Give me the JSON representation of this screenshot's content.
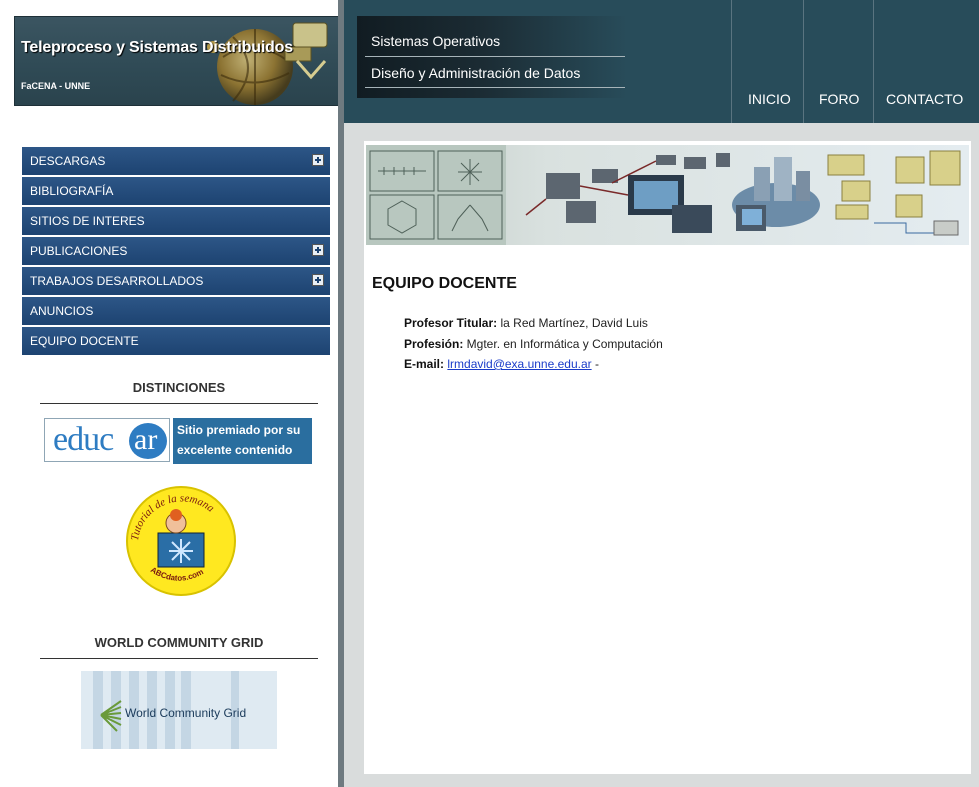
{
  "site": {
    "title": "Teleproceso y Sistemas Distribuidos",
    "subtitle": "FaCENA - UNNE"
  },
  "subjects": [
    "Sistemas Operativos",
    "Diseño y Administración de Datos"
  ],
  "nav": {
    "inicio": "INICIO",
    "foro": "FORO",
    "contacto": "CONTACTO"
  },
  "menu": {
    "items": [
      {
        "label": "DESCARGAS",
        "expandable": true
      },
      {
        "label": "BIBLIOGRAFÍA",
        "expandable": false
      },
      {
        "label": "SITIOS DE INTERES",
        "expandable": false
      },
      {
        "label": "PUBLICACIONES",
        "expandable": true
      },
      {
        "label": "TRABAJOS DESARROLLADOS",
        "expandable": true
      },
      {
        "label": "ANUNCIOS",
        "expandable": false
      },
      {
        "label": "EQUIPO DOCENTE",
        "expandable": false
      }
    ]
  },
  "sidebar": {
    "distinciones_title": "DISTINCIONES",
    "educar_logo": "educar",
    "educar_caption": "Sitio premiado por su excelente contenido",
    "abc_text_top": "Tutorial de la semana",
    "abc_text_bottom": "ABCdatos.com",
    "wcg_title": "WORLD COMMUNITY GRID",
    "wcg_banner": "World Community Grid"
  },
  "content": {
    "heading": "EQUIPO DOCENTE",
    "titular_label": "Profesor Titular:",
    "titular_value": " la Red Martínez, David Luis",
    "profesion_label": "Profesión:",
    "profesion_value": " Mgter. en Informática y Computación",
    "email_label": "E-mail:",
    "email_value": "lrmdavid@exa.unne.edu.ar",
    "email_suffix": " -"
  },
  "colors": {
    "topbar": "#284c5a",
    "menu": "#1d4371",
    "link": "#1a3cc9"
  }
}
